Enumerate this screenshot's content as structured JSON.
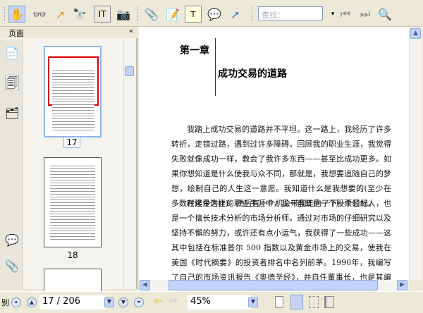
{
  "toolbar": {
    "search_placeholder": "查找：",
    "tools": [
      "hand-tool",
      "select-text-tool",
      "select-tool",
      "zoom-tool",
      "typewriter-tool",
      "snapshot-tool",
      "attach-tool",
      "note-tool",
      "textbox-tool",
      "comment-tool",
      "arrow-tool"
    ]
  },
  "sidebar": {
    "title": "页面",
    "collapse_icon": "«",
    "thumbnails": [
      {
        "page": "17"
      },
      {
        "page": "18"
      }
    ]
  },
  "document": {
    "chapter": "第一章",
    "title": "成功交易的道路",
    "paragraphs": [
      "我踏上成功交易的道路并不平坦。这一路上，我经历了许多转折，走错过路，遇到过许多障碍。回顾我的职业生涯，我觉得失败就像成功一样，教会了我许多东西——甚至比成功更多。如果你想知道是什么使我与众不同，那就是，我想要追随自己的梦想，绘制自己的人生这一意愿。我知道什么是我想要的(至少在多数时候是这样)，然后有一个机会带我走向了下一个目标。",
      "在迄今为止的职业生涯中，我一直既是一个股票经纪人，也是一个擅长技术分析的市场分析师。通过对市场的仔细研究以及坚持不懈的努力，或许还有点小运气，我获得了一些成功——这其中包括在标准普尔 500 指数以及黄金市场上的交易，使我在美国《时代摘要》的投资者排名中名列前茅。1990年，我编写了自己的市场资讯报告《奥德圣经》，并自任董事长，也是其编辑及出版人，我在《奥德圣经》上也发表一些关于标准普尔指数、纳斯达克指数以"
    ]
  },
  "statusbar": {
    "left_label": "别",
    "page_field": "17 / 206",
    "zoom_field": "45%"
  }
}
